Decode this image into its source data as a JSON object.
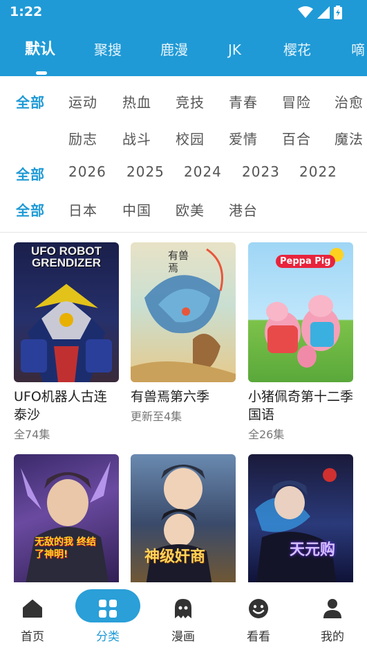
{
  "status": {
    "time": "1:22"
  },
  "tabs": [
    {
      "label": "默认"
    },
    {
      "label": "聚搜"
    },
    {
      "label": "鹿漫"
    },
    {
      "label": "JK"
    },
    {
      "label": "樱花"
    },
    {
      "label": "嘀"
    }
  ],
  "filters": {
    "genre_all": "全部",
    "genres": [
      "运动",
      "热血",
      "竞技",
      "青春",
      "冒险",
      "治愈",
      "励志",
      "战斗",
      "校园",
      "爱情",
      "百合",
      "魔法"
    ],
    "year_all": "全部",
    "years": [
      "2026",
      "2025",
      "2024",
      "2023",
      "2022"
    ],
    "region_all": "全部",
    "regions": [
      "日本",
      "中国",
      "欧美",
      "港台"
    ]
  },
  "cards": [
    {
      "title": "UFO机器人古连泰沙",
      "sub": "全74集",
      "cover_text": "UFO ROBOT GRENDIZER"
    },
    {
      "title": "有兽焉第六季",
      "sub": "更新至4集",
      "cover_text": "有兽焉"
    },
    {
      "title": "小猪佩奇第十二季国语",
      "sub": "全26集",
      "cover_text": "Peppa Pig"
    },
    {
      "title": "",
      "sub": "",
      "cover_text": "无敌的我 终结了神明!"
    },
    {
      "title": "",
      "sub": "",
      "cover_text": "神级奸商"
    },
    {
      "title": "",
      "sub": "",
      "cover_text": "天元购"
    }
  ],
  "nav": [
    {
      "label": "首页",
      "icon": "home-icon"
    },
    {
      "label": "分类",
      "icon": "grid-icon"
    },
    {
      "label": "漫画",
      "icon": "ghost-icon"
    },
    {
      "label": "看看",
      "icon": "smile-icon"
    },
    {
      "label": "我的",
      "icon": "user-icon"
    }
  ],
  "colors": {
    "accent": "#1f9ad6",
    "header_bg": "#1f9ad6"
  }
}
